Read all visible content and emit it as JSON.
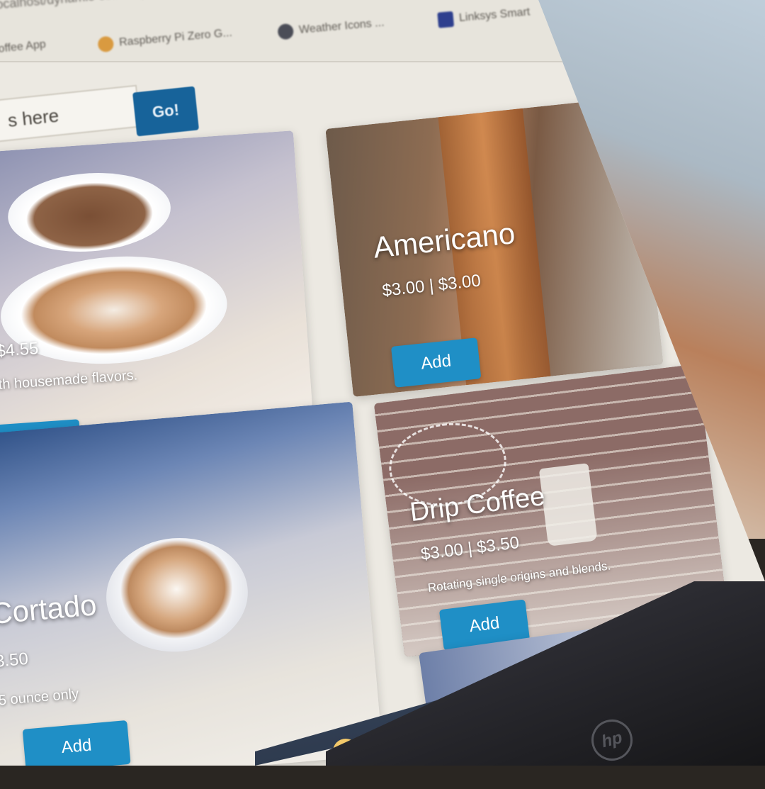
{
  "browser": {
    "url": "localhost/dynamic-coffee/query",
    "bookmarks": [
      {
        "label": "Coffee App",
        "icon": "coffee-icon"
      },
      {
        "label": "Raspberry Pi Zero G...",
        "icon": "raspberry-icon"
      },
      {
        "label": "Weather Icons ...",
        "icon": "weather-icon"
      },
      {
        "label": "Linksys Smart",
        "icon": "linksys-icon"
      }
    ]
  },
  "search": {
    "placeholder": "s here",
    "go_label": "Go!"
  },
  "menu_items": [
    {
      "title": "",
      "price": "$4.55",
      "description": "th housemade flavors.",
      "add_label": "Add"
    },
    {
      "title": "Americano",
      "price": "$3.00 | $3.00",
      "description": "",
      "add_label": "Add"
    },
    {
      "title": "Cortado",
      "price": "3.50",
      "description": "5 ounce only",
      "add_label": "Add"
    },
    {
      "title": "Drip Coffee",
      "price": "$3.00 | $3.50",
      "description": "Rotating single origins and blends.",
      "add_label": "Add"
    }
  ],
  "colors": {
    "primary_button": "#1f8fc6",
    "go_button": "#17639a",
    "page_background": "#ece9e2"
  },
  "device_logo": "hp"
}
